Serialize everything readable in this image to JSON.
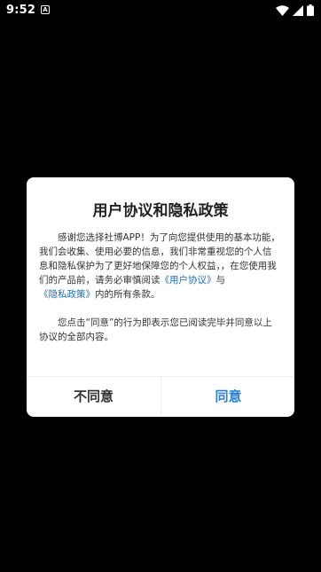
{
  "status_bar": {
    "time": "9:52",
    "notification_icon_label": "A",
    "icons": [
      "wifi-icon",
      "signal-icon",
      "battery-icon"
    ]
  },
  "dialog": {
    "title": "用户协议和隐私政策",
    "paragraph1_part1": "感谢您选择社博APP！为了向您提供使用的基本功能，我们会收集、使用必要的信息，我们非常重视您的个人信息和隐私保护为了更好地保障您的个人权益，，在您使用我们的产品前，请务必审慎阅读",
    "user_agreement_link": "《用户协议》",
    "connector": "与",
    "privacy_policy_link": "《隐私政策》",
    "paragraph1_part2": "内的所有条款。",
    "paragraph2": "您点击“同意”的行为即表示您已阅读完毕并同意以上协议的全部内容。",
    "disagree_label": "不同意",
    "agree_label": "同意"
  },
  "colors": {
    "background": "#000000",
    "dialog_background": "#ffffff",
    "link": "#1a6fb8",
    "agree": "#2a7fd4"
  }
}
